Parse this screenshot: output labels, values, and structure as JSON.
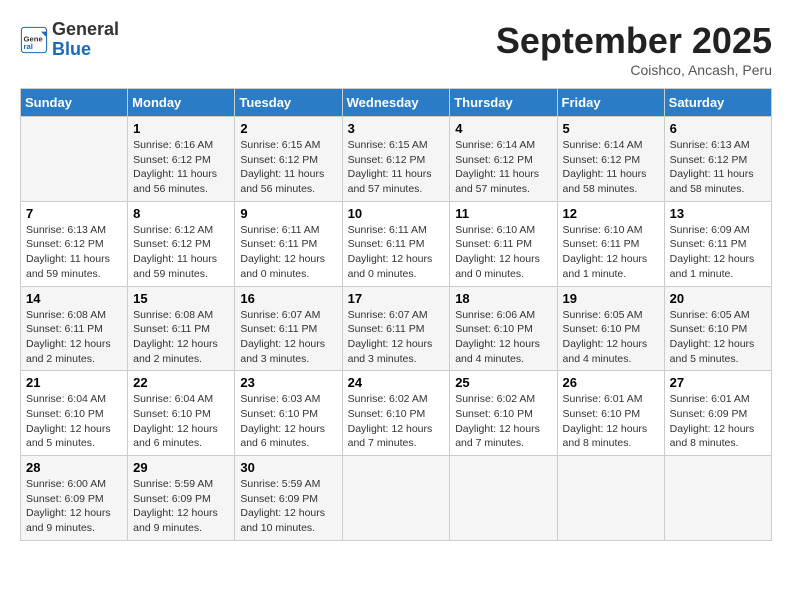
{
  "header": {
    "logo_general": "General",
    "logo_blue": "Blue",
    "month": "September 2025",
    "location": "Coishco, Ancash, Peru"
  },
  "days_of_week": [
    "Sunday",
    "Monday",
    "Tuesday",
    "Wednesday",
    "Thursday",
    "Friday",
    "Saturday"
  ],
  "weeks": [
    [
      {
        "day": "",
        "info": ""
      },
      {
        "day": "1",
        "info": "Sunrise: 6:16 AM\nSunset: 6:12 PM\nDaylight: 11 hours\nand 56 minutes."
      },
      {
        "day": "2",
        "info": "Sunrise: 6:15 AM\nSunset: 6:12 PM\nDaylight: 11 hours\nand 56 minutes."
      },
      {
        "day": "3",
        "info": "Sunrise: 6:15 AM\nSunset: 6:12 PM\nDaylight: 11 hours\nand 57 minutes."
      },
      {
        "day": "4",
        "info": "Sunrise: 6:14 AM\nSunset: 6:12 PM\nDaylight: 11 hours\nand 57 minutes."
      },
      {
        "day": "5",
        "info": "Sunrise: 6:14 AM\nSunset: 6:12 PM\nDaylight: 11 hours\nand 58 minutes."
      },
      {
        "day": "6",
        "info": "Sunrise: 6:13 AM\nSunset: 6:12 PM\nDaylight: 11 hours\nand 58 minutes."
      }
    ],
    [
      {
        "day": "7",
        "info": "Sunrise: 6:13 AM\nSunset: 6:12 PM\nDaylight: 11 hours\nand 59 minutes."
      },
      {
        "day": "8",
        "info": "Sunrise: 6:12 AM\nSunset: 6:12 PM\nDaylight: 11 hours\nand 59 minutes."
      },
      {
        "day": "9",
        "info": "Sunrise: 6:11 AM\nSunset: 6:11 PM\nDaylight: 12 hours\nand 0 minutes."
      },
      {
        "day": "10",
        "info": "Sunrise: 6:11 AM\nSunset: 6:11 PM\nDaylight: 12 hours\nand 0 minutes."
      },
      {
        "day": "11",
        "info": "Sunrise: 6:10 AM\nSunset: 6:11 PM\nDaylight: 12 hours\nand 0 minutes."
      },
      {
        "day": "12",
        "info": "Sunrise: 6:10 AM\nSunset: 6:11 PM\nDaylight: 12 hours\nand 1 minute."
      },
      {
        "day": "13",
        "info": "Sunrise: 6:09 AM\nSunset: 6:11 PM\nDaylight: 12 hours\nand 1 minute."
      }
    ],
    [
      {
        "day": "14",
        "info": "Sunrise: 6:08 AM\nSunset: 6:11 PM\nDaylight: 12 hours\nand 2 minutes."
      },
      {
        "day": "15",
        "info": "Sunrise: 6:08 AM\nSunset: 6:11 PM\nDaylight: 12 hours\nand 2 minutes."
      },
      {
        "day": "16",
        "info": "Sunrise: 6:07 AM\nSunset: 6:11 PM\nDaylight: 12 hours\nand 3 minutes."
      },
      {
        "day": "17",
        "info": "Sunrise: 6:07 AM\nSunset: 6:11 PM\nDaylight: 12 hours\nand 3 minutes."
      },
      {
        "day": "18",
        "info": "Sunrise: 6:06 AM\nSunset: 6:10 PM\nDaylight: 12 hours\nand 4 minutes."
      },
      {
        "day": "19",
        "info": "Sunrise: 6:05 AM\nSunset: 6:10 PM\nDaylight: 12 hours\nand 4 minutes."
      },
      {
        "day": "20",
        "info": "Sunrise: 6:05 AM\nSunset: 6:10 PM\nDaylight: 12 hours\nand 5 minutes."
      }
    ],
    [
      {
        "day": "21",
        "info": "Sunrise: 6:04 AM\nSunset: 6:10 PM\nDaylight: 12 hours\nand 5 minutes."
      },
      {
        "day": "22",
        "info": "Sunrise: 6:04 AM\nSunset: 6:10 PM\nDaylight: 12 hours\nand 6 minutes."
      },
      {
        "day": "23",
        "info": "Sunrise: 6:03 AM\nSunset: 6:10 PM\nDaylight: 12 hours\nand 6 minutes."
      },
      {
        "day": "24",
        "info": "Sunrise: 6:02 AM\nSunset: 6:10 PM\nDaylight: 12 hours\nand 7 minutes."
      },
      {
        "day": "25",
        "info": "Sunrise: 6:02 AM\nSunset: 6:10 PM\nDaylight: 12 hours\nand 7 minutes."
      },
      {
        "day": "26",
        "info": "Sunrise: 6:01 AM\nSunset: 6:10 PM\nDaylight: 12 hours\nand 8 minutes."
      },
      {
        "day": "27",
        "info": "Sunrise: 6:01 AM\nSunset: 6:09 PM\nDaylight: 12 hours\nand 8 minutes."
      }
    ],
    [
      {
        "day": "28",
        "info": "Sunrise: 6:00 AM\nSunset: 6:09 PM\nDaylight: 12 hours\nand 9 minutes."
      },
      {
        "day": "29",
        "info": "Sunrise: 5:59 AM\nSunset: 6:09 PM\nDaylight: 12 hours\nand 9 minutes."
      },
      {
        "day": "30",
        "info": "Sunrise: 5:59 AM\nSunset: 6:09 PM\nDaylight: 12 hours\nand 10 minutes."
      },
      {
        "day": "",
        "info": ""
      },
      {
        "day": "",
        "info": ""
      },
      {
        "day": "",
        "info": ""
      },
      {
        "day": "",
        "info": ""
      }
    ]
  ]
}
